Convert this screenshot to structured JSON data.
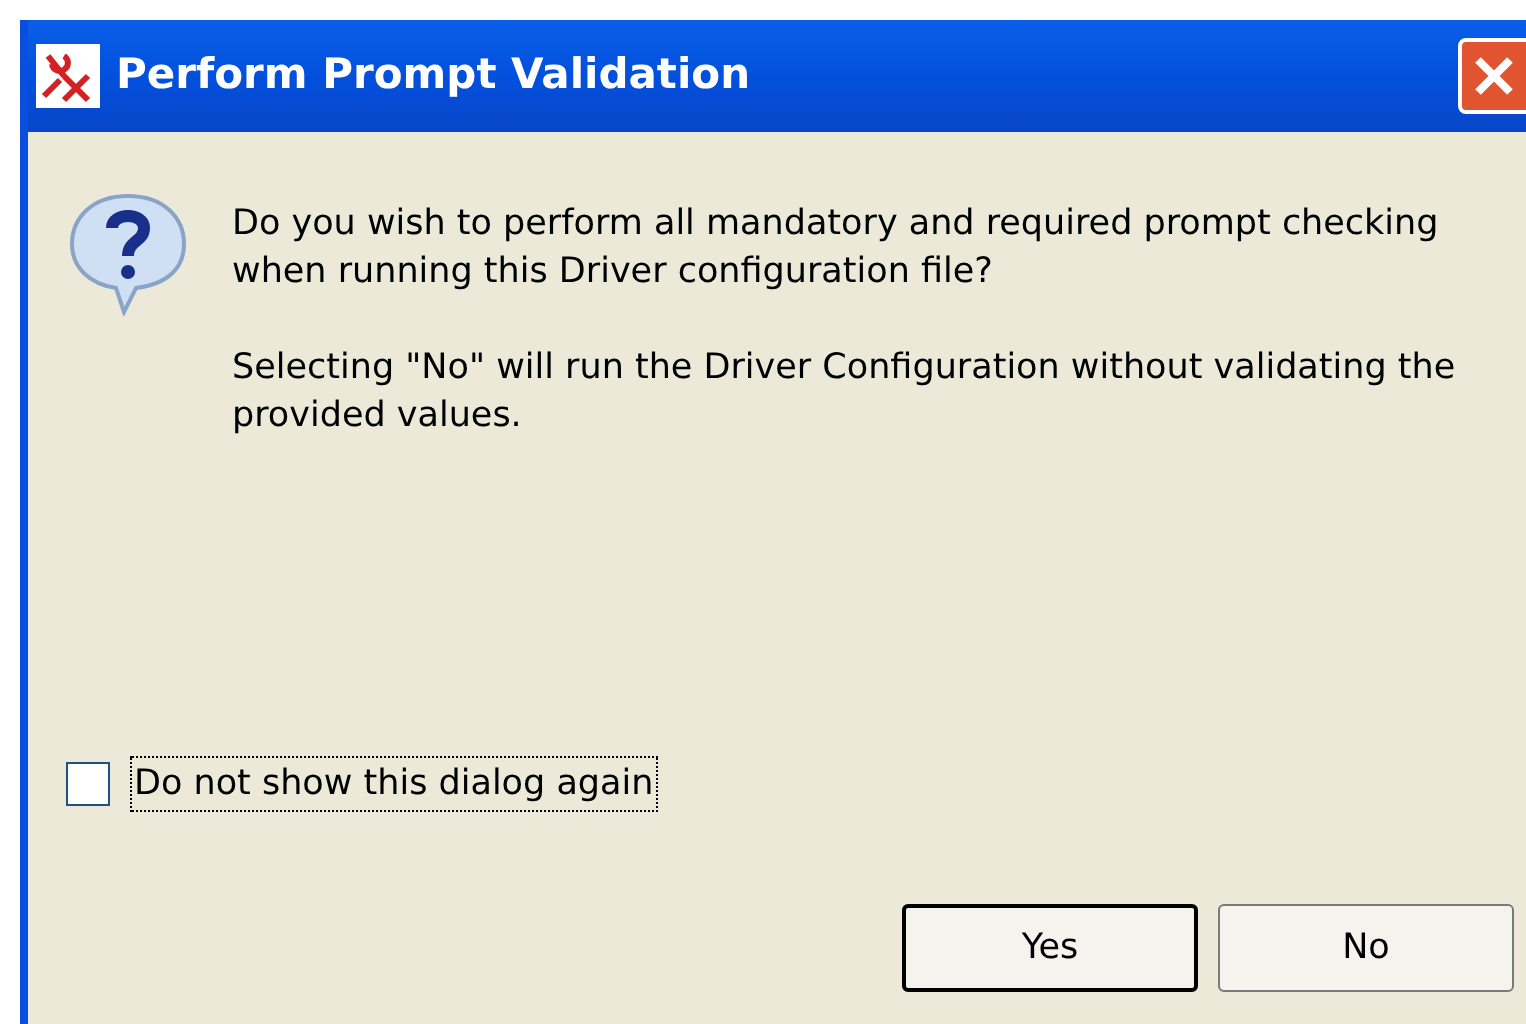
{
  "window": {
    "title": "Perform Prompt Validation"
  },
  "message": {
    "question": "Do you wish to perform all mandatory and required prompt checking when running this Driver configuration file?",
    "note": "Selecting \"No\" will run the Driver Configuration without validating the provided values."
  },
  "checkbox": {
    "label": "Do not show this dialog again",
    "checked": false
  },
  "buttons": [
    {
      "label": "Yes",
      "default": true
    },
    {
      "label": "No",
      "default": false
    }
  ]
}
